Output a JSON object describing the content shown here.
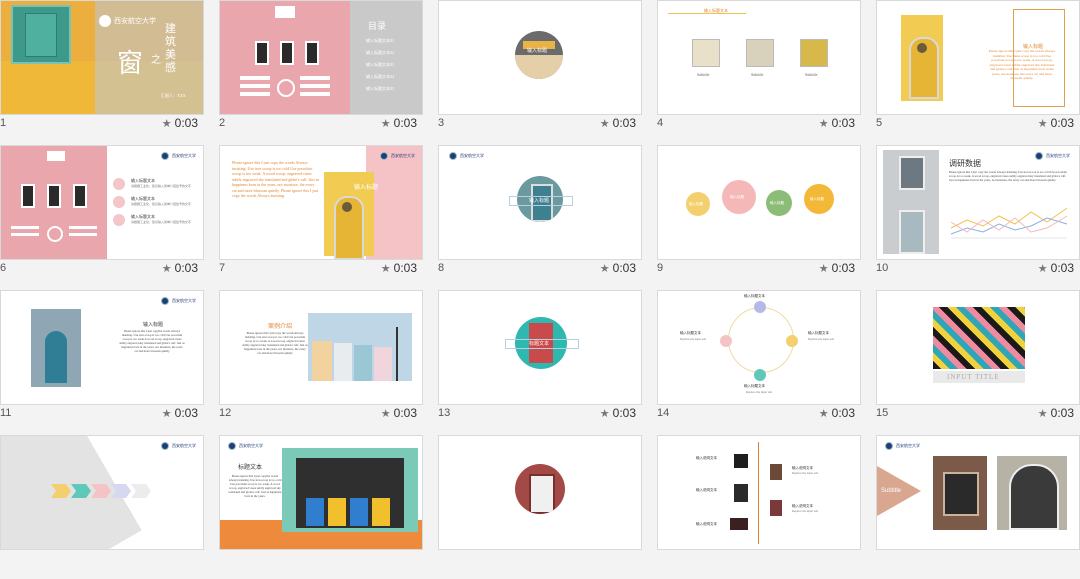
{
  "slides": [
    {
      "num": "1",
      "time": "0:03",
      "school": "西安航空大学",
      "title_char": "窗",
      "zhi": "之",
      "subtitle": "建筑美感",
      "presenter": "汇报人：XXX"
    },
    {
      "num": "2",
      "time": "0:03",
      "toc_title": "目录",
      "toc_items": [
        "输入标题文本01",
        "输入标题文本02",
        "输入标题文本03",
        "输入标题文本04",
        "输入标题文本05"
      ]
    },
    {
      "num": "3",
      "time": "0:03",
      "label": "输入标题"
    },
    {
      "num": "4",
      "time": "0:03",
      "header": "输入标题文本",
      "captions": [
        "Subtitle",
        "Subtitle",
        "Subtitle"
      ]
    },
    {
      "num": "5",
      "time": "0:03",
      "heading": "输入标题",
      "body": "Please ignore this I just copy the words Always insisting. Use these scoop is too cold Use porcelain scoop is too weak. A wood scoop, engraved vases subtly engraved sky translated and globe's calf. Just as happiness born in the years, not moisture, the every cat and more blossom quietly."
    },
    {
      "num": "6",
      "time": "0:03",
      "items": [
        {
          "title": "输入标题文本",
          "desc": "请根据工业化，建议输入简单介绍给予的文字"
        },
        {
          "title": "输入标题文本",
          "desc": "请根据工业化，建议输入简单介绍给予的文字"
        },
        {
          "title": "输入标题文本",
          "desc": "请根据工业化，建议输入简单介绍给予的文字"
        }
      ]
    },
    {
      "num": "7",
      "time": "0:03",
      "body": "Please ignore this I just copy the words Always insisting. Use iron scoop is too cold Use porcelain scoop is too weak. A wood scoop, engraved vases subtly engraved sky translated and globe's calf. Just as happiness born in the years, not moisture, the every cat and more blossom quietly. Please ignore this I just copy the words Always insisting.",
      "label": "输入标题"
    },
    {
      "num": "8",
      "time": "0:03",
      "label": "输入标题"
    },
    {
      "num": "9",
      "time": "0:03",
      "circles": [
        "输入标题",
        "输入标题",
        "输入标题",
        "输入标题"
      ]
    },
    {
      "num": "10",
      "time": "0:03",
      "heading": "调研数据",
      "body": "Please ignore this I just copy the words Always insisting. Use iron scoop is too cold Use porcelain scoop is too weak. A wood scoop, engraved vases subtly engraved sky translated and globe's calf. Just as happiness born in the years, not moisture, the every cat and more blossom quietly."
    },
    {
      "num": "11",
      "time": "0:03",
      "heading": "输入标题",
      "body": "Please ignore this I just copythe words Always insisting. Use iron scoop is too cold Use porcelain scoop is too weak A wood scoop, engraved vases subtly engraved sky translated and globe's calf. Just as happiness born in the years, not moisture, the every cat and more blossom quietly"
    },
    {
      "num": "12",
      "time": "0:03",
      "heading": "案例介绍",
      "body": "Please ignore this I just copy the words Always insisting. Use iron scoop is too cold Use porcelain scoop is too weak. A wood scoop, engraved vases subtly engraved sky translated and globe's calf. Just as happiness born in the years, not moisture, the every cat and more blossom quietly"
    },
    {
      "num": "13",
      "time": "0:03",
      "label": "标题文本"
    },
    {
      "num": "14",
      "time": "0:03",
      "nodes": [
        "输入标题文本",
        "输入标题文本",
        "输入标题文本",
        "输入标题文本"
      ],
      "desc": "Replace the input text"
    },
    {
      "num": "15",
      "time": "0:03",
      "title": "INPUT TITLE"
    },
    {
      "num": "16",
      "time": "0:03"
    },
    {
      "num": "17",
      "time": "0:03",
      "heading": "标题文本",
      "body": "Please ignore this I just copythe words Always insisting. Use iron scoop is too cold Use porcelain scoop is too weak. A wood scoop, engraved vases subtly engraved sky translated and globe's calf. Just as happiness born in the years."
    },
    {
      "num": "18",
      "time": "0:03",
      "items": [
        "输入说明文本",
        "输入说明文本",
        "输入说明文本",
        "输入说明文本",
        "输入说明文本"
      ],
      "desc": "Replace the input text"
    },
    {
      "num": "19",
      "time": "0:03",
      "label": "Subtitle"
    }
  ]
}
